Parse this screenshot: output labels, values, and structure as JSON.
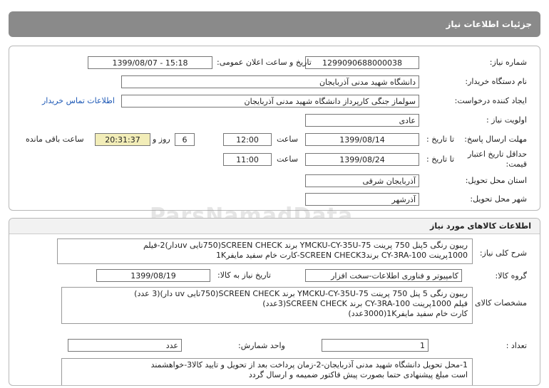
{
  "header": {
    "title": "جزئیات اطلاعات نیاز"
  },
  "fields": {
    "need_number_label": "شماره نیاز:",
    "need_number": "1299090688000038",
    "announce_label": "تاریخ و ساعت اعلان عمومی:",
    "announce_value": "1399/08/07 - 15:18",
    "buyer_label": "نام دستگاه خریدار:",
    "buyer_value": "دانشگاه شهید مدنی آذربایجان",
    "requester_label": "ایجاد کننده درخواست:",
    "requester_value": "سولماز جنگی کارپرداز دانشگاه شهید مدنی آذربایجان",
    "contact_link": "اطلاعات تماس خریدار",
    "priority_label": "اولویت نیاز :",
    "priority_value": "عادی",
    "deadline_label": "مهلت ارسال پاسخ:",
    "to_date_label": "تا تاریخ :",
    "deadline_date": "1399/08/14",
    "time_label": "ساعت",
    "deadline_time": "12:00",
    "days_value": "6",
    "days_label": "روز و",
    "remaining_time": "20:31:37",
    "remaining_label": "ساعت باقی مانده",
    "validity_label_1": "حداقل تاریخ اعتبار",
    "validity_label_2": "قیمت:",
    "validity_to_label": "تا تاریخ :",
    "validity_date": "1399/08/24",
    "validity_time_label": "ساعت",
    "validity_time": "11:00",
    "province_label": "استان محل تحویل:",
    "province_value": "آذربایجان شرقی",
    "city_label": "شهر محل تحویل:",
    "city_value": "آذرشهر"
  },
  "goods": {
    "section_title": "اطلاعات کالاهای مورد نیاز",
    "general_label": "شرح کلی نیاز:",
    "general_line1": "ریبون رنگی 5پنل 750 پرینت YMCKU-CY-35U-75 برند SCREEN CHECK(750تایی uvدار)2-فیلم",
    "general_line2": "1000پرینت CY-3RA-100 برندSCREEN CHECK3-کارت خام سفید مایفر1K",
    "group_label": "گروه کالا:",
    "group_value": "کامپیوتر و فناوری اطلاعات-سخت افزار",
    "need_date_label": "تاریخ نیاز به کالا:",
    "need_date": "1399/08/19",
    "spec_label": "مشخصات کالای مورد نیاز:",
    "spec_line1": "ریبون رنگی 5 پنل 750 پرینت YMCKU-CY-35U-75 برند SCREEN CHECK(750تایی uv دار)(3 عدد)",
    "spec_line2": "فیلم 1000پرینت CY-3RA-100 برند SCREEN CHECK(3عدد)",
    "spec_line3": "کارت خام سفید مایفر1K(3000عدد)",
    "quantity_label": "تعداد :",
    "quantity_value": "1",
    "unit_label": "واحد شمارش:",
    "unit_value": "عدد",
    "notes_line1": "1-محل تحویل دانشگاه شهید مدنی آذربایجان-2-زمان پرداخت بعد از تحویل و تایید کالا3-خواهشمند",
    "notes_line2": "است مبلغ پیشنهادی حتما بصورت پیش فاکتور ضمیمه و ارسال گردد"
  },
  "watermark": "ParsNamadData"
}
